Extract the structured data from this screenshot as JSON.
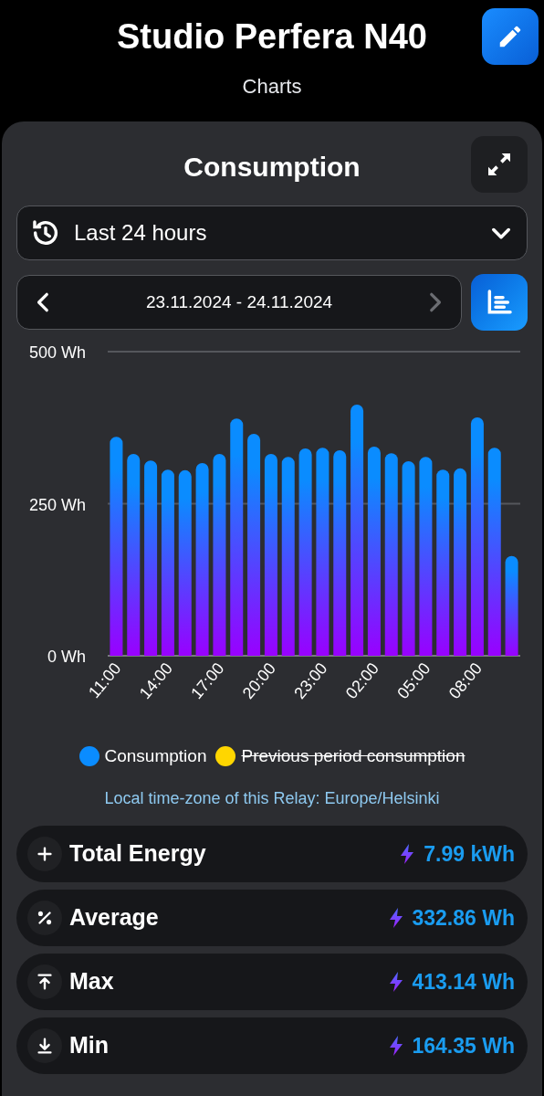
{
  "header": {
    "title": "Studio Perfera N40",
    "subtitle": "Charts"
  },
  "card": {
    "title": "Consumption",
    "range": {
      "label": "Last 24 hours"
    },
    "date_nav": {
      "label": "23.11.2024 - 24.11.2024",
      "next_disabled": true
    },
    "chart_data": {
      "type": "bar",
      "series": [
        {
          "name": "Consumption",
          "color": "#0a8cff",
          "values": [
            360,
            332,
            321,
            306,
            305,
            317,
            332,
            390,
            365,
            332,
            327,
            341,
            342,
            338,
            413,
            344,
            333,
            320,
            327,
            306,
            308,
            392,
            342,
            164
          ]
        }
      ],
      "categories": [
        "11:00",
        null,
        null,
        "14:00",
        null,
        null,
        "17:00",
        null,
        null,
        "20:00",
        null,
        null,
        "23:00",
        null,
        null,
        "02:00",
        null,
        null,
        "05:00",
        null,
        null,
        "08:00",
        null,
        null
      ],
      "ylim": [
        0,
        500
      ],
      "yticks": [
        {
          "value": 0,
          "label": "0 Wh"
        },
        {
          "value": 250,
          "label": "250 Wh"
        },
        {
          "value": 500,
          "label": "500 Wh"
        }
      ]
    },
    "legend": [
      {
        "label": "Previous period consumption",
        "color": "#ffd600",
        "hidden": true
      }
    ],
    "timezone_note": "Local time-zone of this Relay: Europe/Helsinki",
    "stats": [
      {
        "kind": "plus",
        "label": "Total Energy",
        "value": "7.99 kWh"
      },
      {
        "kind": "percent",
        "label": "Average",
        "value": "332.86 Wh"
      },
      {
        "kind": "max",
        "label": "Max",
        "value": "413.14 Wh"
      },
      {
        "kind": "min",
        "label": "Min",
        "value": "164.35 Wh"
      }
    ]
  }
}
